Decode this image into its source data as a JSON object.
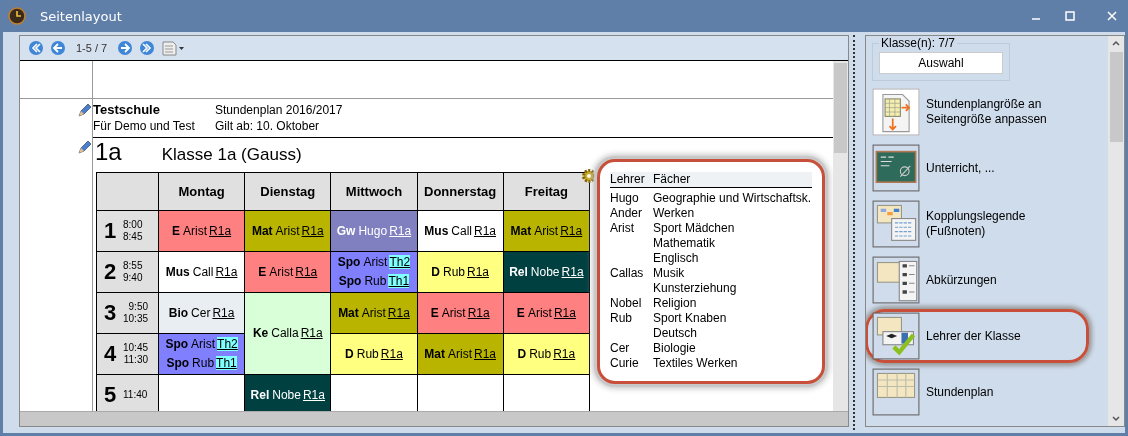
{
  "window": {
    "title": "Seitenlayout"
  },
  "toolbar": {
    "page_indicator": "1-5 / 7"
  },
  "document": {
    "school": "Testschule",
    "subtitle": "Für Demo und Test",
    "plan": "Stundenplan 2016/2017",
    "valid_from": "Gilt ab: 10. Oktober",
    "class_short": "1a",
    "class_title": "Klasse 1a (Gauss)"
  },
  "timetable": {
    "days": [
      "Montag",
      "Dienstag",
      "Mittwoch",
      "Donnerstag",
      "Freitag"
    ],
    "periods": [
      {
        "number": "1",
        "start": "8:00",
        "end": "8:45",
        "cells": [
          {
            "color": "#ff8080",
            "lessons": [
              {
                "subject": "E",
                "teacher": "Arist",
                "room": "R1a",
                "room_marked": false
              }
            ]
          },
          {
            "color": "#b8b400",
            "lessons": [
              {
                "subject": "Mat",
                "teacher": "Arist",
                "room": "R1a",
                "room_marked": false
              }
            ]
          },
          {
            "color": "#8080c0",
            "lessons": [
              {
                "subject": "Gw",
                "teacher": "Hugo",
                "room": "R1a",
                "room_marked": false
              }
            ]
          },
          {
            "color": "#ffffff",
            "lessons": [
              {
                "subject": "Mus",
                "teacher": "Call",
                "room": "R1a",
                "room_marked": false
              }
            ]
          },
          {
            "color": "#b8b400",
            "lessons": [
              {
                "subject": "Mat",
                "teacher": "Arist",
                "room": "R1a",
                "room_marked": false
              }
            ]
          }
        ]
      },
      {
        "number": "2",
        "start": "8:55",
        "end": "9:40",
        "cells": [
          {
            "color": "#ffffff",
            "lessons": [
              {
                "subject": "Mus",
                "teacher": "Call",
                "room": "R1a",
                "room_marked": false
              }
            ]
          },
          {
            "color": "#ff8080",
            "lessons": [
              {
                "subject": "E",
                "teacher": "Arist",
                "room": "R1a",
                "room_marked": false
              }
            ]
          },
          {
            "color": "#8080ff",
            "lessons": [
              {
                "subject": "Spo",
                "teacher": "Arist",
                "room": "Th2",
                "room_marked": true
              },
              {
                "subject": "Spo",
                "teacher": "Rub",
                "room": "Th1",
                "room_marked": true
              }
            ]
          },
          {
            "color": "#ffff80",
            "lessons": [
              {
                "subject": "D",
                "teacher": "Rub",
                "room": "R1a",
                "room_marked": false
              }
            ]
          },
          {
            "color": "#004040",
            "lessons": [
              {
                "subject": "Rel",
                "teacher": "Nobe",
                "room": "R1a",
                "room_marked": false
              }
            ]
          }
        ]
      },
      {
        "number": "3",
        "start": "9:50",
        "end": "10:35",
        "cells": [
          {
            "color": "#e8eef2",
            "lessons": [
              {
                "subject": "Bio",
                "teacher": "Cer",
                "room": "R1a",
                "room_marked": false
              }
            ]
          },
          {
            "color": "#d8ffd8",
            "rowspan": 2,
            "lessons": [
              {
                "subject": "Ke",
                "teacher": "Calla",
                "room": "R1a",
                "room_marked": false
              }
            ]
          },
          {
            "color": "#b8b400",
            "lessons": [
              {
                "subject": "Mat",
                "teacher": "Arist",
                "room": "R1a",
                "room_marked": false
              }
            ]
          },
          {
            "color": "#ff8080",
            "lessons": [
              {
                "subject": "E",
                "teacher": "Arist",
                "room": "R1a",
                "room_marked": false
              }
            ]
          },
          {
            "color": "#ff8080",
            "lessons": [
              {
                "subject": "E",
                "teacher": "Arist",
                "room": "R1a",
                "room_marked": false
              }
            ]
          }
        ]
      },
      {
        "number": "4",
        "start": "10:45",
        "end": "11:30",
        "cells": [
          {
            "color": "#8080ff",
            "lessons": [
              {
                "subject": "Spo",
                "teacher": "Arist",
                "room": "Th2",
                "room_marked": true
              },
              {
                "subject": "Spo",
                "teacher": "Rub",
                "room": "Th1",
                "room_marked": true
              }
            ]
          },
          {
            "color": "#ffff80",
            "lessons": [
              {
                "subject": "D",
                "teacher": "Rub",
                "room": "R1a",
                "room_marked": false
              }
            ]
          },
          {
            "color": "#b8b400",
            "lessons": [
              {
                "subject": "Mat",
                "teacher": "Arist",
                "room": "R1a",
                "room_marked": false
              }
            ]
          },
          {
            "color": "#ffff80",
            "lessons": [
              {
                "subject": "D",
                "teacher": "Rub",
                "room": "R1a",
                "room_marked": false
              }
            ]
          }
        ]
      },
      {
        "number": "5",
        "start": "11:40",
        "cells": [
          {
            "color": "#ffffff"
          },
          {
            "color": "#004040",
            "lessons": [
              {
                "subject": "Rel",
                "teacher": "Nobe",
                "room": "R1a",
                "room_marked": false
              }
            ]
          },
          {
            "color": "#ffffff"
          },
          {
            "color": "#ffffff"
          },
          {
            "color": "#ffffff"
          }
        ]
      }
    ]
  },
  "legend": {
    "highlighted": true,
    "header": [
      "Lehrer",
      "Fächer"
    ],
    "rows": [
      {
        "teacher": "Hugo",
        "subjects": [
          "Geographie und Wirtschaftsk."
        ]
      },
      {
        "teacher": "Ander",
        "subjects": [
          "Werken"
        ]
      },
      {
        "teacher": "Arist",
        "subjects": [
          "Sport Mädchen",
          "Mathematik",
          "Englisch"
        ]
      },
      {
        "teacher": "Callas",
        "subjects": [
          "Musik",
          "Kunsterziehung"
        ]
      },
      {
        "teacher": "Nobel",
        "subjects": [
          "Religion"
        ]
      },
      {
        "teacher": "Rub",
        "subjects": [
          "Sport Knaben",
          "Deutsch"
        ]
      },
      {
        "teacher": "Cer",
        "subjects": [
          "Biologie"
        ]
      },
      {
        "teacher": "Curie",
        "subjects": [
          "Textiles Werken"
        ]
      }
    ]
  },
  "sidebar": {
    "class_label": "Klasse(n): 7/7",
    "select_button": "Auswahl",
    "items": [
      {
        "kind": "resize",
        "label": "Stundenplangröße an Seitengröße anpassen",
        "highlighted": false
      },
      {
        "kind": "board",
        "label": "Unterricht, ...",
        "highlighted": false
      },
      {
        "kind": "legend",
        "label": "Kopplungslegende (Fußnoten)",
        "highlighted": false
      },
      {
        "kind": "abbrev",
        "label": "Abkürzungen",
        "highlighted": false
      },
      {
        "kind": "teachers",
        "label": "Lehrer der Klasse",
        "highlighted": true
      },
      {
        "kind": "plan",
        "label": "Stundenplan",
        "highlighted": false
      }
    ]
  }
}
